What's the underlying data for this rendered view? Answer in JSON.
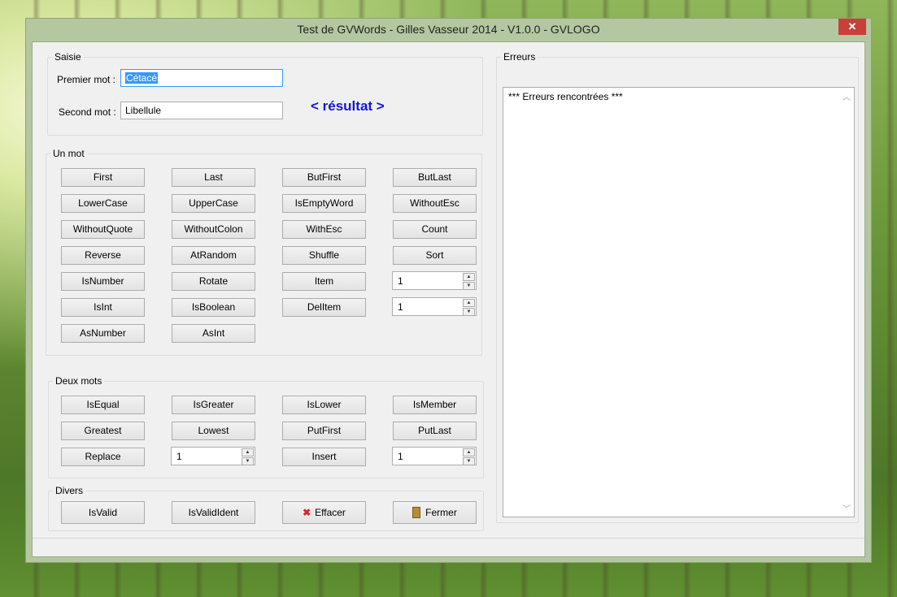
{
  "window": {
    "title": "Test de GVWords - Gilles Vasseur 2014 - V1.0.0 - GVLOGO",
    "close": "✕"
  },
  "saisie": {
    "legend": "Saisie",
    "first_label": "Premier mot :",
    "first_value": "Cétacé",
    "second_label": "Second mot :",
    "second_value": "Libellule",
    "result": "< résultat >"
  },
  "un_mot": {
    "legend": "Un mot",
    "buttons": [
      "First",
      "Last",
      "ButFirst",
      "ButLast",
      "LowerCase",
      "UpperCase",
      "IsEmptyWord",
      "WithoutEsc",
      "WithoutQuote",
      "WithoutColon",
      "WithEsc",
      "Count",
      "Reverse",
      "AtRandom",
      "Shuffle",
      "Sort",
      "IsNumber",
      "Rotate",
      "Item",
      "IsInt",
      "IsBoolean",
      "DelItem",
      "AsNumber",
      "AsInt"
    ],
    "item_spin": "1",
    "delitem_spin": "1"
  },
  "deux_mots": {
    "legend": "Deux mots",
    "buttons": [
      "IsEqual",
      "IsGreater",
      "IsLower",
      "IsMember",
      "Greatest",
      "Lowest",
      "PutFirst",
      "PutLast",
      "Replace",
      "Insert"
    ],
    "replace_spin": "1",
    "insert_spin": "1"
  },
  "divers": {
    "legend": "Divers",
    "is_valid": "IsValid",
    "is_valid_ident": "IsValidIdent",
    "effacer": "Effacer",
    "fermer": "Fermer"
  },
  "erreurs": {
    "legend": "Erreurs",
    "text": "*** Erreurs rencontrées ***"
  }
}
